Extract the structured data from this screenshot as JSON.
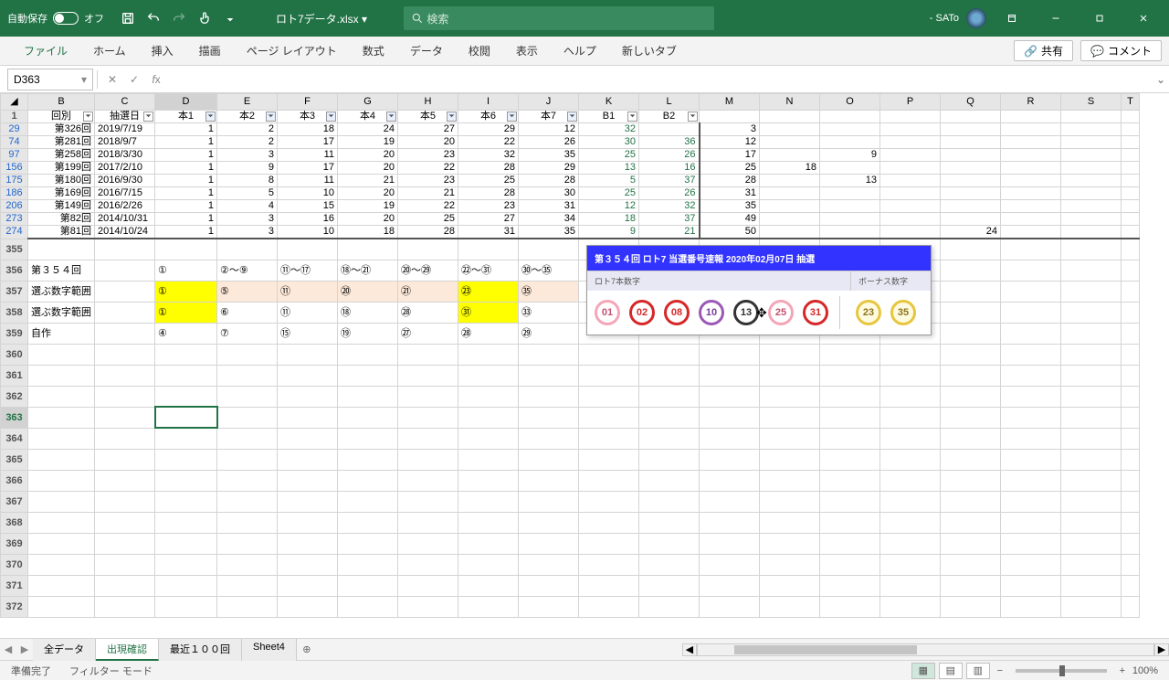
{
  "autosave": {
    "label": "自動保存",
    "state": "オフ"
  },
  "filename": "ロト7データ.xlsx",
  "search_placeholder": "検索",
  "user": "- SATo",
  "ribbon": [
    "ファイル",
    "ホーム",
    "挿入",
    "描画",
    "ページ レイアウト",
    "数式",
    "データ",
    "校閲",
    "表示",
    "ヘルプ",
    "新しいタブ"
  ],
  "share": "共有",
  "comment": "コメント",
  "namebox": "D363",
  "columns": [
    "B",
    "C",
    "D",
    "E",
    "F",
    "G",
    "H",
    "I",
    "J",
    "K",
    "L",
    "M",
    "N",
    "O",
    "P",
    "Q",
    "R",
    "S",
    "T"
  ],
  "headers": {
    "B": "回別",
    "C": "抽選日",
    "D": "本1",
    "E": "本2",
    "F": "本3",
    "G": "本4",
    "H": "本5",
    "I": "本6",
    "J": "本7",
    "K": "B1",
    "L": "B2"
  },
  "data_rows": [
    {
      "rn": "29",
      "cells": [
        "第326回",
        "2019/7/19",
        "1",
        "2",
        "18",
        "24",
        "27",
        "29",
        "12",
        "32"
      ]
    },
    {
      "rn": "74",
      "cells": [
        "第281回",
        "2018/9/7",
        "1",
        "2",
        "17",
        "19",
        "20",
        "22",
        "26",
        "30",
        "36"
      ]
    },
    {
      "rn": "97",
      "cells": [
        "第258回",
        "2018/3/30",
        "1",
        "3",
        "11",
        "20",
        "23",
        "32",
        "35",
        "25",
        "26"
      ]
    },
    {
      "rn": "156",
      "cells": [
        "第199回",
        "2017/2/10",
        "1",
        "9",
        "17",
        "20",
        "22",
        "28",
        "29",
        "13",
        "16"
      ]
    },
    {
      "rn": "175",
      "cells": [
        "第180回",
        "2016/9/30",
        "1",
        "8",
        "11",
        "21",
        "23",
        "25",
        "28",
        "5",
        "37"
      ]
    },
    {
      "rn": "186",
      "cells": [
        "第169回",
        "2016/7/15",
        "1",
        "5",
        "10",
        "20",
        "21",
        "28",
        "30",
        "25",
        "26"
      ]
    },
    {
      "rn": "206",
      "cells": [
        "第149回",
        "2016/2/26",
        "1",
        "4",
        "15",
        "19",
        "22",
        "23",
        "31",
        "12",
        "32"
      ]
    },
    {
      "rn": "273",
      "cells": [
        "第82回",
        "2014/10/31",
        "1",
        "3",
        "16",
        "20",
        "25",
        "27",
        "34",
        "18",
        "37"
      ]
    },
    {
      "rn": "274",
      "cells": [
        "第81回",
        "2014/10/24",
        "1",
        "3",
        "10",
        "18",
        "28",
        "31",
        "35",
        "9",
        "21"
      ]
    }
  ],
  "side_nums": {
    "M": [
      "3",
      "12",
      "17",
      "25",
      "28",
      "31",
      "35",
      "49",
      "50"
    ],
    "N18": "18",
    "O13": "13",
    "O9": "9",
    "Q24": "24"
  },
  "range_rows": [
    {
      "rn": "356",
      "B": "第３５４回",
      "D": "①",
      "E": "②～⑨",
      "F": "⑪～⑰",
      "G": "⑱～㉑",
      "H": "⑳～㉙",
      "I": "㉒～㉛",
      "J": "㉚～㉟"
    },
    {
      "rn": "357",
      "B": "選ぶ数字範囲",
      "D": "①",
      "E": "⑤",
      "F": "⑪",
      "G": "⑳",
      "H": "㉑",
      "I": "㉓",
      "J": "㉟",
      "hl": [
        "D",
        "I"
      ],
      "peach": [
        "E",
        "F",
        "G",
        "H",
        "J"
      ]
    },
    {
      "rn": "358",
      "B": "選ぶ数字範囲",
      "D": "①",
      "E": "⑥",
      "F": "⑪",
      "G": "⑱",
      "H": "㉘",
      "I": "㉛",
      "J": "㉝",
      "hl": [
        "D",
        "I"
      ]
    },
    {
      "rn": "359",
      "B": "自作",
      "D": "④",
      "E": "⑦",
      "F": "⑮",
      "G": "⑲",
      "H": "㉗",
      "I": "㉘",
      "J": "㉙"
    }
  ],
  "blank_rows": [
    "355",
    "360",
    "361",
    "362",
    "363",
    "364",
    "365",
    "366",
    "367",
    "368",
    "369",
    "370",
    "371",
    "372"
  ],
  "loto": {
    "title": "第３５４回   ロト7 当選番号速報   2020年02月07日 抽選",
    "main_label": "ロト7本数字",
    "bonus_label": "ボーナス数字",
    "balls": [
      {
        "n": "01",
        "c": "pink"
      },
      {
        "n": "02",
        "c": "red"
      },
      {
        "n": "08",
        "c": "red"
      },
      {
        "n": "10",
        "c": "purple"
      },
      {
        "n": "13",
        "c": "black"
      },
      {
        "n": "25",
        "c": "pink"
      },
      {
        "n": "31",
        "c": "red"
      }
    ],
    "bonus": [
      {
        "n": "23",
        "c": "yellow"
      },
      {
        "n": "35",
        "c": "yellow"
      }
    ]
  },
  "sheets": [
    "全データ",
    "出現確認",
    "最近１００回",
    "Sheet4"
  ],
  "active_sheet": 1,
  "status": {
    "ready": "準備完了",
    "filter": "フィルター モード",
    "zoom": "100%"
  }
}
